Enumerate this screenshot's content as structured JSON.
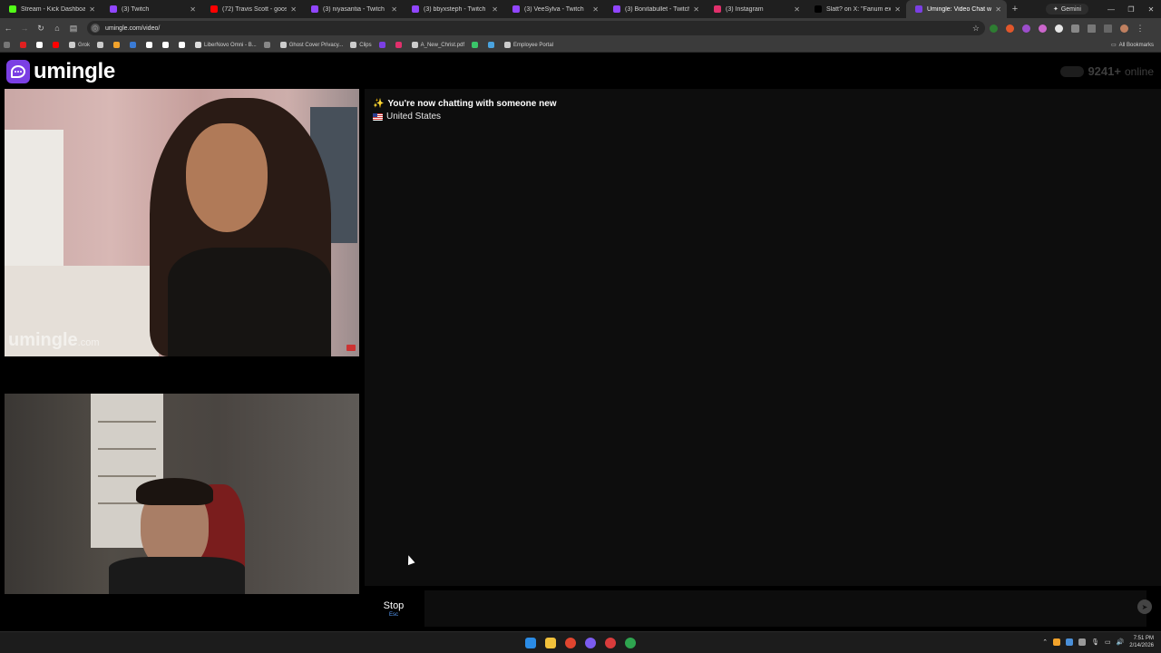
{
  "browser": {
    "tabs": [
      {
        "title": "Stream - Kick Dashboard",
        "color": "#53fc18",
        "active": false
      },
      {
        "title": "(3) Twitch",
        "color": "#9146ff",
        "active": false
      },
      {
        "title": "(72) Travis Scott - goosebum",
        "color": "#ff0000",
        "active": false
      },
      {
        "title": "(3) niyasantia - Twitch",
        "color": "#9146ff",
        "active": false
      },
      {
        "title": "(3) bbyxsteph - Twitch",
        "color": "#9146ff",
        "active": false
      },
      {
        "title": "(3) VeeSylva - Twitch",
        "color": "#9146ff",
        "active": false
      },
      {
        "title": "(3) Bonitabullet - Twitch",
        "color": "#9146ff",
        "active": false
      },
      {
        "title": "(3) Instagram",
        "color": "#e1306c",
        "active": false
      },
      {
        "title": "Slatt? on X: \"Fanum exposes",
        "color": "#000000",
        "active": false
      },
      {
        "title": "Umingle: Video Chat wi",
        "color": "#7b3fe4",
        "active": true
      }
    ],
    "gemini_label": "Gemini",
    "url": "umingle.com/video/",
    "bookmarks": [
      {
        "label": "",
        "color": "#e02020"
      },
      {
        "label": "",
        "color": "#ffffff"
      },
      {
        "label": "",
        "color": "#ff0000"
      },
      {
        "label": "Grok",
        "color": "#cccccc"
      },
      {
        "label": "",
        "color": "#cccccc"
      },
      {
        "label": "",
        "color": "#f2a32c"
      },
      {
        "label": "",
        "color": "#3a7bd5"
      },
      {
        "label": "",
        "color": "#ffffff"
      },
      {
        "label": "",
        "color": "#ffffff"
      },
      {
        "label": "",
        "color": "#ffffff"
      },
      {
        "label": "LiberNovo Omni - B...",
        "color": "#dddddd"
      },
      {
        "label": "",
        "color": "#888888"
      },
      {
        "label": "Ghost Cover Privacy...",
        "color": "#cccccc"
      },
      {
        "label": "Clips",
        "color": "#cccccc"
      },
      {
        "label": "",
        "color": "#7b3fe4"
      },
      {
        "label": "",
        "color": "#e1306c"
      },
      {
        "label": "A_New_Christ.pdf",
        "color": "#cccccc"
      },
      {
        "label": "",
        "color": "#3ac569"
      },
      {
        "label": "",
        "color": "#4aa3df"
      },
      {
        "label": "Employee Portal",
        "color": "#cccccc"
      }
    ],
    "all_bookmarks": "All Bookmarks"
  },
  "site": {
    "logo_text": "umingle",
    "online_count": "9241+",
    "online_word": "online",
    "accent": "#7b3fe4"
  },
  "video": {
    "watermark_main": "umingle",
    "watermark_tld": ".com"
  },
  "chat": {
    "system_message": "You're now chatting with someone new",
    "system_icon": "✨",
    "country": "United States"
  },
  "composer": {
    "stop_label": "Stop",
    "stop_key": "Esc",
    "input_value": "",
    "input_placeholder": ""
  },
  "taskbar": {
    "time": "7:51 PM",
    "date": "2/14/2026"
  }
}
